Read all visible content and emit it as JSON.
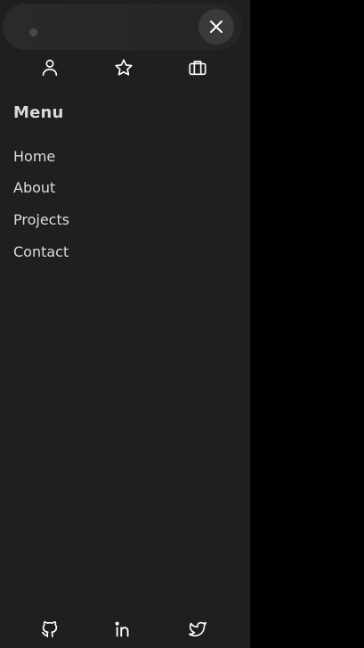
{
  "drawer": {
    "menu_title": "Menu",
    "nav_items": [
      {
        "label": "Home"
      },
      {
        "label": "About"
      },
      {
        "label": "Projects"
      },
      {
        "label": "Contact"
      }
    ],
    "quick_icons": [
      "user-icon",
      "star-icon",
      "briefcase-icon"
    ],
    "social_icons": [
      "github-icon",
      "linkedin-icon",
      "twitter-icon"
    ],
    "close_icon": "close-icon"
  },
  "colors": {
    "background": "#000000",
    "drawer_bg": "#1f1f20",
    "text": "#dcdcdc",
    "icon": "#ffffff",
    "close_button_bg": "#3a3a3b"
  }
}
